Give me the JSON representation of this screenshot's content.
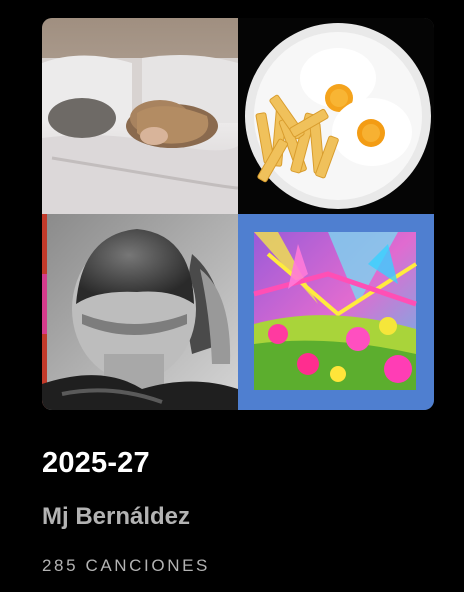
{
  "playlist": {
    "title": "2025-27",
    "owner": "Mj Bernáldez",
    "song_count": "285 CANCIONES"
  },
  "cover": {
    "tiles": [
      "woman-lying-in-bed-photo",
      "fried-eggs-and-fries-plate-photo",
      "back-of-head-haircut-bw-photo",
      "colorful-flowers-abstract-art"
    ]
  },
  "colors": {
    "background": "#000000",
    "title": "#ffffff",
    "secondary_text": "#b3b3b3",
    "blue_frame": "#4f7fd0"
  }
}
